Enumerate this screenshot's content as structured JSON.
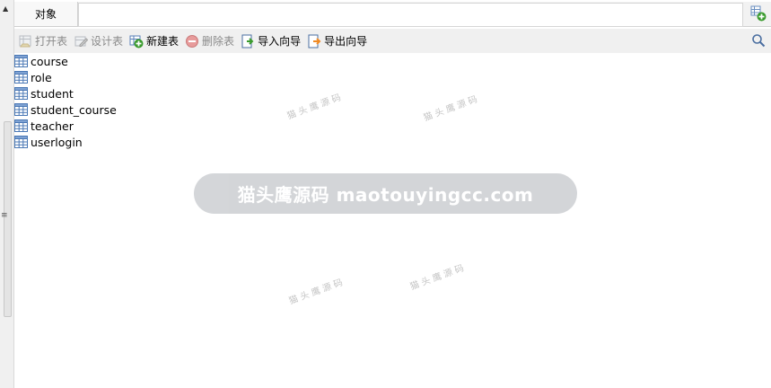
{
  "tabs": [
    {
      "label": "对象"
    }
  ],
  "toolbar": {
    "open_table": "打开表",
    "design_table": "设计表",
    "new_table": "新建表",
    "delete_table": "删除表",
    "import_wizard": "导入向导",
    "export_wizard": "导出向导"
  },
  "tables": [
    "course",
    "role",
    "student",
    "student_course",
    "teacher",
    "userlogin"
  ],
  "watermark": {
    "main": "猫头鹰源码 maotouyingcc.com",
    "small": "猫 头 鹰 源 码"
  },
  "icons": {
    "open": "open-table-icon",
    "design": "design-table-icon",
    "new": "new-table-icon",
    "delete": "delete-table-icon",
    "import": "import-icon",
    "export": "export-icon",
    "search": "search-icon",
    "table": "table-icon",
    "new_tab": "new-tab-icon"
  },
  "colors": {
    "new_green": "#3a9b2e",
    "delete_red": "#d9534f",
    "export_orange": "#f08a24",
    "table_blue": "#4a78b5"
  }
}
